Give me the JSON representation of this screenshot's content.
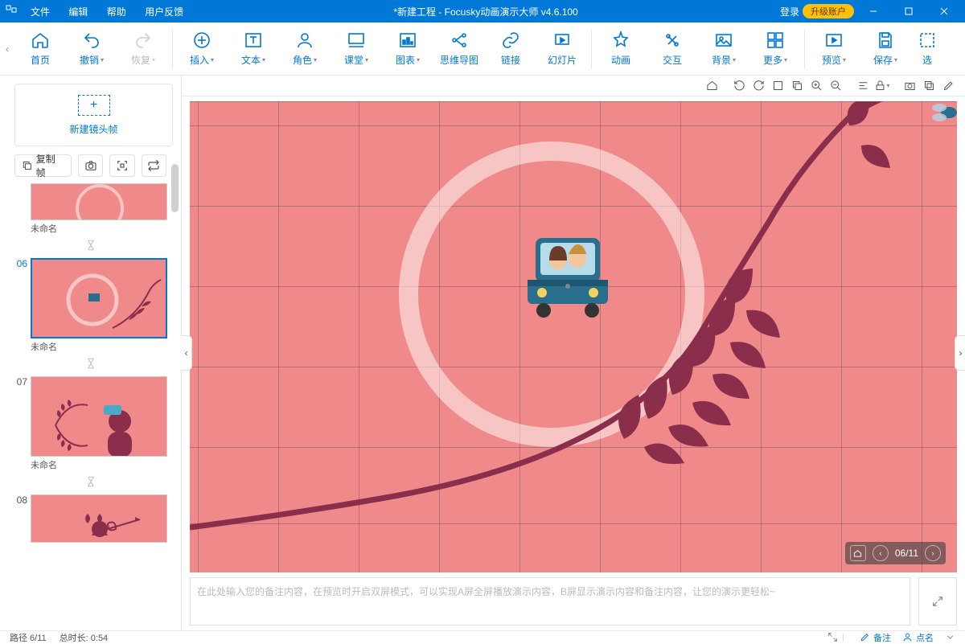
{
  "titlebar": {
    "menus": [
      "文件",
      "编辑",
      "帮助",
      "用户反馈"
    ],
    "title": "*新建工程 - Focusky动画演示大师  v4.6.100",
    "login": "登录",
    "upgrade": "升级账户"
  },
  "toolbar": {
    "home": "首页",
    "undo": "撤销",
    "redo": "恢复",
    "insert": "插入",
    "text": "文本",
    "role": "角色",
    "class": "课堂",
    "chart": "图表",
    "mindmap": "思维导图",
    "link": "链接",
    "slide": "幻灯片",
    "anim": "动画",
    "interact": "交互",
    "bg": "背景",
    "more": "更多",
    "preview": "预览",
    "save": "保存",
    "select": "选"
  },
  "sidebar": {
    "newframe": "新建镜头帧",
    "copy": "复制帧",
    "thumb_label": "未命名",
    "nums": {
      "n6": "06",
      "n7": "07",
      "n8": "08"
    }
  },
  "canvas": {
    "pager": "06/11",
    "notes_placeholder": "在此处输入您的备注内容，在预览时开启双屏模式，可以实现A屏全屏播放演示内容，B屏显示演示内容和备注内容，让您的演示更轻松~"
  },
  "status": {
    "path": "路径 6/11",
    "duration": "总时长: 0:54",
    "note": "备注",
    "click": "点名"
  }
}
